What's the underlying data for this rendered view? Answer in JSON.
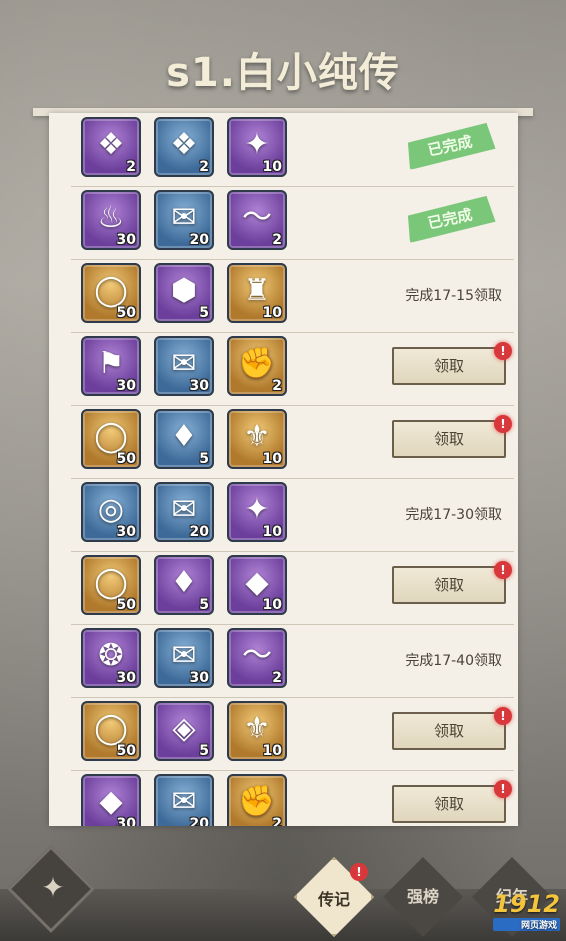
{
  "title": "s1.白小纯传",
  "rows": [
    {
      "items": [
        {
          "color": "purple",
          "icon": "treasure-chest-icon",
          "glyph": "❖",
          "qty": "2"
        },
        {
          "color": "blue",
          "icon": "treasure-chest-icon",
          "glyph": "❖",
          "qty": "2"
        },
        {
          "color": "purple",
          "icon": "emblem-card-icon",
          "glyph": "✦",
          "qty": "10"
        }
      ],
      "status": "stamp",
      "text": "已完成"
    },
    {
      "items": [
        {
          "color": "purple",
          "icon": "meat-icon",
          "glyph": "♨",
          "qty": "30"
        },
        {
          "color": "blue",
          "icon": "scroll-icon",
          "glyph": "✉",
          "qty": "20"
        },
        {
          "color": "purple",
          "icon": "dolphin-icon",
          "glyph": "〜",
          "qty": "2"
        }
      ],
      "status": "stamp",
      "text": "已完成"
    },
    {
      "items": [
        {
          "color": "gold",
          "icon": "ring-icon",
          "glyph": "◯",
          "qty": "50"
        },
        {
          "color": "purple",
          "icon": "gem-shield-icon",
          "glyph": "⬢",
          "qty": "5"
        },
        {
          "color": "gold",
          "icon": "armor-icon",
          "glyph": "♜",
          "qty": "10"
        }
      ],
      "status": "text",
      "text": "完成17-15领取"
    },
    {
      "items": [
        {
          "color": "purple",
          "icon": "banner-icon",
          "glyph": "⚑",
          "qty": "30"
        },
        {
          "color": "blue",
          "icon": "scroll-icon",
          "glyph": "✉",
          "qty": "30"
        },
        {
          "color": "gold",
          "icon": "fist-medal-icon",
          "glyph": "✊",
          "qty": "2"
        }
      ],
      "status": "button",
      "text": "领取"
    },
    {
      "items": [
        {
          "color": "gold",
          "icon": "ring-icon",
          "glyph": "◯",
          "qty": "50"
        },
        {
          "color": "blue",
          "icon": "flame-crystal-icon",
          "glyph": "♦",
          "qty": "5"
        },
        {
          "color": "gold",
          "icon": "badge-icon",
          "glyph": "⚜",
          "qty": "10"
        }
      ],
      "status": "button",
      "text": "领取"
    },
    {
      "items": [
        {
          "color": "blue",
          "icon": "swirl-icon",
          "glyph": "◎",
          "qty": "30"
        },
        {
          "color": "blue",
          "icon": "scroll-icon",
          "glyph": "✉",
          "qty": "20"
        },
        {
          "color": "purple",
          "icon": "emblem-card-icon",
          "glyph": "✦",
          "qty": "10"
        }
      ],
      "status": "text",
      "text": "完成17-30领取"
    },
    {
      "items": [
        {
          "color": "gold",
          "icon": "ring-icon",
          "glyph": "◯",
          "qty": "50"
        },
        {
          "color": "purple",
          "icon": "red-gem-icon",
          "glyph": "♦",
          "qty": "5"
        },
        {
          "color": "purple",
          "icon": "ore-icon",
          "glyph": "◆",
          "qty": "10"
        }
      ],
      "status": "button",
      "text": "领取"
    },
    {
      "items": [
        {
          "color": "purple",
          "icon": "flame-orb-icon",
          "glyph": "❂",
          "qty": "30"
        },
        {
          "color": "blue",
          "icon": "scroll-icon",
          "glyph": "✉",
          "qty": "30"
        },
        {
          "color": "purple",
          "icon": "dolphin-icon",
          "glyph": "〜",
          "qty": "2"
        }
      ],
      "status": "text",
      "text": "完成17-40领取"
    },
    {
      "items": [
        {
          "color": "gold",
          "icon": "ring-icon",
          "glyph": "◯",
          "qty": "50"
        },
        {
          "color": "purple",
          "icon": "green-gem-icon",
          "glyph": "◈",
          "qty": "5"
        },
        {
          "color": "gold",
          "icon": "badge-icon",
          "glyph": "⚜",
          "qty": "10"
        }
      ],
      "status": "button",
      "text": "领取"
    },
    {
      "items": [
        {
          "color": "purple",
          "icon": "crystal-icon",
          "glyph": "◆",
          "qty": "30"
        },
        {
          "color": "blue",
          "icon": "scroll-icon",
          "glyph": "✉",
          "qty": "20"
        },
        {
          "color": "gold",
          "icon": "fist-medal-icon",
          "glyph": "✊",
          "qty": "2"
        }
      ],
      "status": "button",
      "text": "领取"
    }
  ],
  "alert_mark": "!",
  "tabs": [
    {
      "label": "传记",
      "active": true,
      "alert": true
    },
    {
      "label": "强榜",
      "active": false,
      "alert": false
    },
    {
      "label": "纪年",
      "active": false,
      "alert": false
    }
  ],
  "home_icon": "diamond-emblem-icon",
  "watermark": {
    "logo": "1912",
    "badge": "yx",
    "sub": "网页游戏"
  }
}
